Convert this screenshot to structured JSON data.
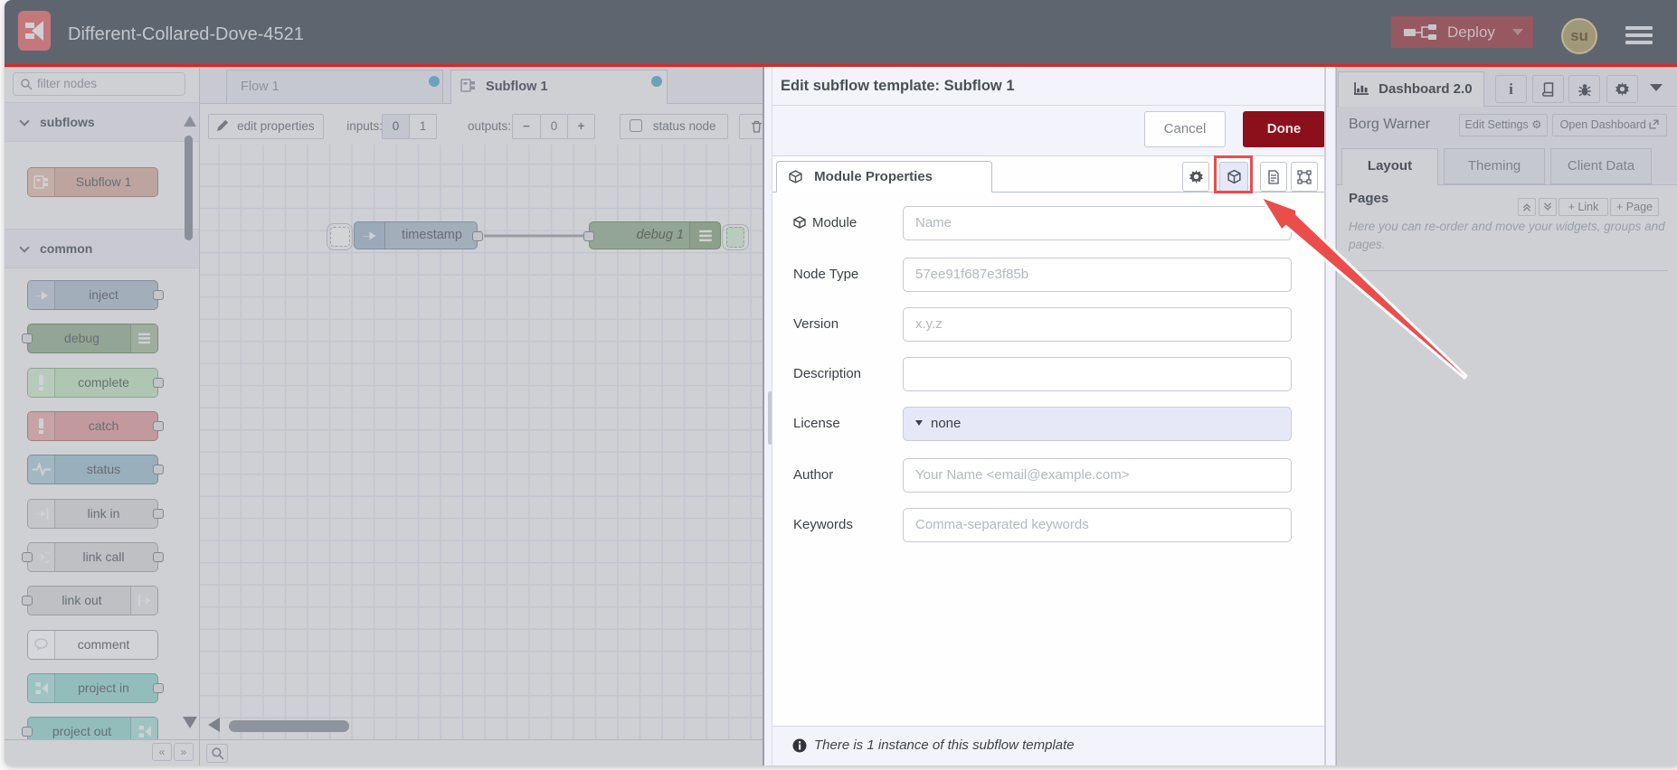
{
  "header": {
    "title": "Different-Collared-Dove-4521",
    "deploy_label": "Deploy",
    "avatar_initials": "su"
  },
  "palette": {
    "filter_placeholder": "filter nodes",
    "categories": [
      {
        "label": "subflows",
        "nodes": [
          {
            "label": "Subflow 1",
            "icon": "subflow-icon",
            "bg": "#bda59f",
            "border": "#9d8981",
            "iconSide": "left",
            "ports": []
          }
        ]
      },
      {
        "label": "common",
        "nodes": [
          {
            "label": "inject",
            "icon": "inject-icon",
            "bg": "#a3aebb",
            "border": "#848f9c",
            "iconSide": "left",
            "ports": [
              "right"
            ]
          },
          {
            "label": "debug",
            "icon": "debug-icon",
            "bg": "#93a594",
            "border": "#798b73",
            "iconSide": "right",
            "ports": [
              "left"
            ]
          },
          {
            "label": "complete",
            "icon": "complete-icon",
            "bg": "#afc6b3",
            "border": "#8fa392",
            "iconSide": "left",
            "ports": [
              "right"
            ]
          },
          {
            "label": "catch",
            "icon": "catch-icon",
            "bg": "#c2999c",
            "border": "#a17d80",
            "iconSide": "left",
            "ports": [
              "right"
            ]
          },
          {
            "label": "status",
            "icon": "status-icon",
            "bg": "#99afbb",
            "border": "#7b8f9b",
            "iconSide": "left",
            "ports": [
              "right"
            ]
          },
          {
            "label": "link in",
            "icon": "link-in-icon",
            "bg": "#bec0c3",
            "border": "#9b9ea3",
            "iconSide": "left",
            "ports": [
              "right"
            ]
          },
          {
            "label": "link call",
            "icon": "link-call-icon",
            "bg": "#bec0c3",
            "border": "#9b9ea3",
            "iconSide": "left",
            "ports": [
              "left",
              "right"
            ]
          },
          {
            "label": "link out",
            "icon": "link-out-icon",
            "bg": "#bec0c3",
            "border": "#9b9ea3",
            "iconSide": "right",
            "ports": [
              "left"
            ]
          },
          {
            "label": "comment",
            "icon": "comment-icon",
            "bg": "#d2d3d6",
            "border": "#9b9ea6",
            "iconSide": "left",
            "ports": []
          },
          {
            "label": "project in",
            "icon": "project-icon",
            "bg": "#93bdbb",
            "border": "#76a19c",
            "iconSide": "left",
            "ports": [
              "right"
            ]
          },
          {
            "label": "project out",
            "icon": "project-icon",
            "bg": "#93bdbb",
            "border": "#76a19c",
            "iconSide": "right",
            "ports": [
              "left"
            ]
          }
        ]
      }
    ]
  },
  "workspace": {
    "tabs": [
      {
        "label": "Flow 1"
      },
      {
        "label": "Subflow 1"
      }
    ],
    "toolbar": {
      "edit_properties_label": "edit properties",
      "inputs_label": "inputs:",
      "inputs_options": [
        "0",
        "1"
      ],
      "inputs_selected": "0",
      "outputs_label": "outputs:",
      "outputs_value": "0",
      "status_node_label": "status node"
    },
    "nodes": [
      {
        "label": "timestamp"
      },
      {
        "label": "debug 1"
      }
    ]
  },
  "dialog": {
    "title": "Edit subflow template: Subflow 1",
    "cancel_label": "Cancel",
    "done_label": "Done",
    "tab_label": "Module Properties",
    "fields": [
      {
        "label": "Module",
        "placeholder": "Name",
        "icon": "cube-icon",
        "type": "text"
      },
      {
        "label": "Node Type",
        "placeholder": "57ee91f687e3f85b",
        "type": "text"
      },
      {
        "label": "Version",
        "placeholder": "x.y.z",
        "type": "text"
      },
      {
        "label": "Description",
        "placeholder": "",
        "type": "text"
      },
      {
        "label": "License",
        "value": "none",
        "type": "select"
      },
      {
        "label": "Author",
        "placeholder": "Your Name <email@example.com>",
        "type": "text"
      },
      {
        "label": "Keywords",
        "placeholder": "Comma-separated keywords",
        "type": "text"
      }
    ],
    "footer_text": "There is 1 instance of this subflow template"
  },
  "sidebar": {
    "tab_label": "Dashboard 2.0",
    "project_name": "Borg Warner",
    "edit_settings_label": "Edit Settings",
    "open_dashboard_label": "Open Dashboard",
    "tabs": [
      "Layout",
      "Theming",
      "Client Data"
    ],
    "active_tab": "Layout",
    "pages_label": "Pages",
    "collapse_all_label": "collapse-all",
    "expand_all_label": "expand-all",
    "link_button_label": "+ Link",
    "page_button_label": "+ Page",
    "help_text": "Here you can re-order and move your widgets, groups and pages."
  },
  "colors": {
    "header_accent": "#d12b2b",
    "annotation": "#eb4d4b",
    "deploy_bg": "#965962",
    "done_bg": "#8c101c"
  }
}
